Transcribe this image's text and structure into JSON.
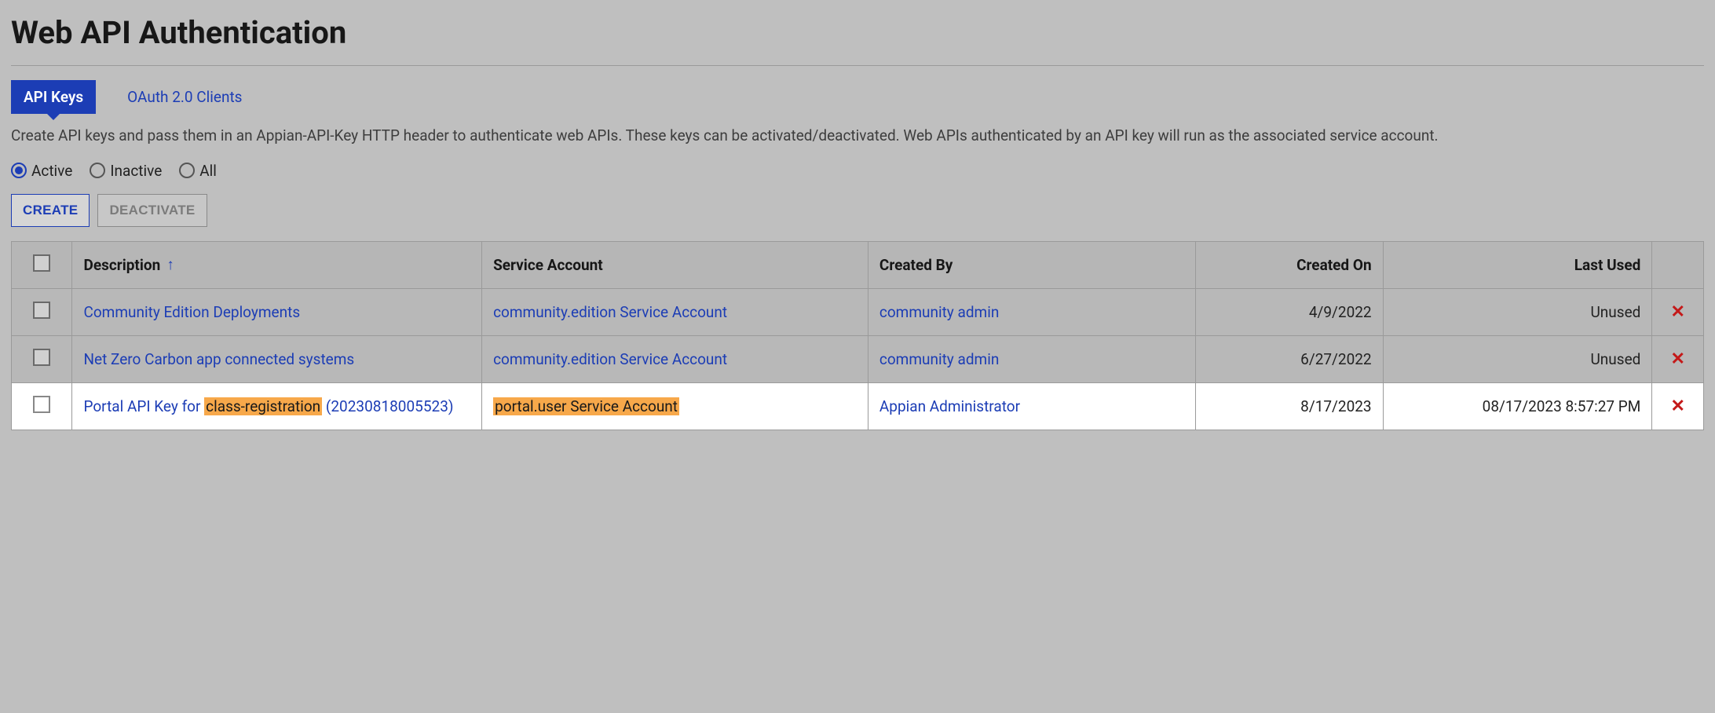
{
  "page": {
    "title": "Web API Authentication",
    "description": "Create API keys and pass them in an Appian-API-Key HTTP header to authenticate web APIs. These keys can be activated/deactivated. Web APIs authenticated by an API key will run as the associated service account."
  },
  "tabs": {
    "api_keys": "API Keys",
    "oauth": "OAuth 2.0 Clients",
    "active": "api_keys"
  },
  "filter": {
    "active": "Active",
    "inactive": "Inactive",
    "all": "All",
    "selected": "active"
  },
  "actions": {
    "create": "CREATE",
    "deactivate": "DEACTIVATE"
  },
  "table": {
    "headers": {
      "description": "Description",
      "service_account": "Service Account",
      "created_by": "Created By",
      "created_on": "Created On",
      "last_used": "Last Used"
    },
    "sort_column": "description",
    "sort_dir": "asc",
    "rows": [
      {
        "description_prefix": "",
        "description_highlight": "",
        "description_main": "Community Edition Deployments",
        "description_suffix": "",
        "service_account": "community.edition Service Account",
        "service_highlight": false,
        "created_by": "community admin",
        "created_on": "4/9/2022",
        "last_used": "Unused",
        "highlighted": false
      },
      {
        "description_prefix": "",
        "description_highlight": "",
        "description_main": "Net Zero Carbon app connected systems",
        "description_suffix": "",
        "service_account": "community.edition Service Account",
        "service_highlight": false,
        "created_by": "community admin",
        "created_on": "6/27/2022",
        "last_used": "Unused",
        "highlighted": false
      },
      {
        "description_prefix": "Portal API Key for ",
        "description_highlight": "class-registration",
        "description_main": "",
        "description_suffix": " (20230818005523)",
        "service_account": "portal.user Service Account",
        "service_highlight": true,
        "created_by": "Appian Administrator",
        "created_on": "8/17/2023",
        "last_used": "08/17/2023 8:57:27 PM",
        "highlighted": true
      }
    ]
  }
}
